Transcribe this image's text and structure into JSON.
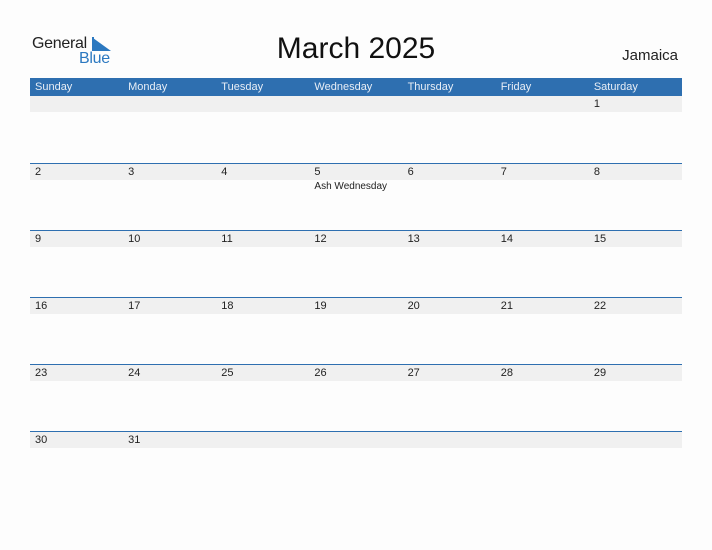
{
  "logo": {
    "general": "General",
    "blue": "Blue"
  },
  "title": "March 2025",
  "country": "Jamaica",
  "weekdays": [
    "Sunday",
    "Monday",
    "Tuesday",
    "Wednesday",
    "Thursday",
    "Friday",
    "Saturday"
  ],
  "weeks": [
    [
      {
        "d": ""
      },
      {
        "d": ""
      },
      {
        "d": ""
      },
      {
        "d": ""
      },
      {
        "d": ""
      },
      {
        "d": ""
      },
      {
        "d": "1"
      }
    ],
    [
      {
        "d": "2"
      },
      {
        "d": "3"
      },
      {
        "d": "4"
      },
      {
        "d": "5",
        "event": "Ash Wednesday"
      },
      {
        "d": "6"
      },
      {
        "d": "7"
      },
      {
        "d": "8"
      }
    ],
    [
      {
        "d": "9"
      },
      {
        "d": "10"
      },
      {
        "d": "11"
      },
      {
        "d": "12"
      },
      {
        "d": "13"
      },
      {
        "d": "14"
      },
      {
        "d": "15"
      }
    ],
    [
      {
        "d": "16"
      },
      {
        "d": "17"
      },
      {
        "d": "18"
      },
      {
        "d": "19"
      },
      {
        "d": "20"
      },
      {
        "d": "21"
      },
      {
        "d": "22"
      }
    ],
    [
      {
        "d": "23"
      },
      {
        "d": "24"
      },
      {
        "d": "25"
      },
      {
        "d": "26"
      },
      {
        "d": "27"
      },
      {
        "d": "28"
      },
      {
        "d": "29"
      }
    ],
    [
      {
        "d": "30"
      },
      {
        "d": "31"
      },
      {
        "d": ""
      },
      {
        "d": ""
      },
      {
        "d": ""
      },
      {
        "d": ""
      },
      {
        "d": ""
      }
    ]
  ]
}
